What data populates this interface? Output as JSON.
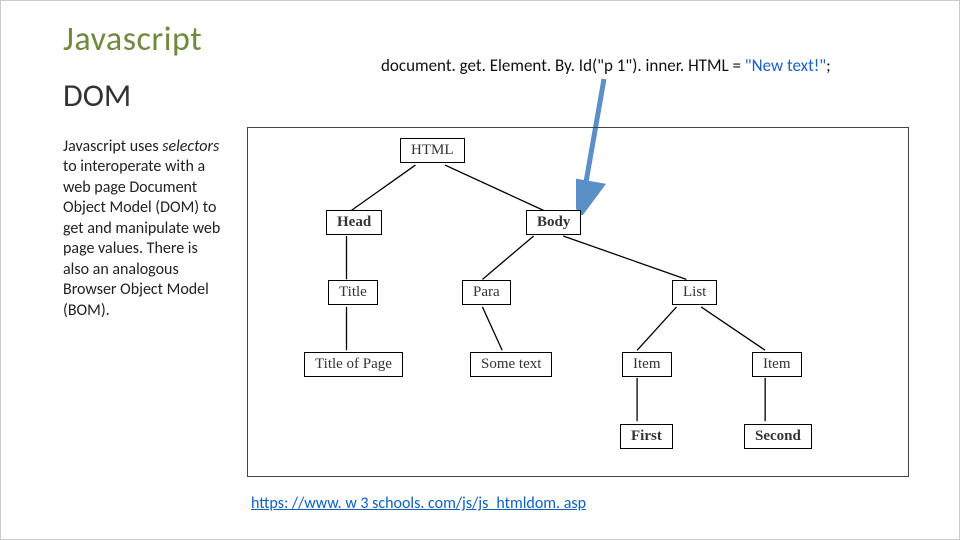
{
  "title": "Javascript",
  "subtitle": "DOM",
  "code": {
    "prefix": "document. get. Element. By. Id(\"p 1\"). inner. HTML = ",
    "string": "\"New text!\"",
    "suffix": ";"
  },
  "description": {
    "line1": "Javascript uses ",
    "emph": "selectors",
    "rest": " to interoperate with a web page Document Object Model (DOM) to get and manipulate web page values. There is also an analogous Browser Object Model (BOM)."
  },
  "tree": {
    "root": "HTML",
    "l1": {
      "head": "Head",
      "body": "Body"
    },
    "l2": {
      "title": "Title",
      "para": "Para",
      "list": "List"
    },
    "l3": {
      "titlepg": "Title of Page",
      "sometext": "Some text",
      "item1": "Item",
      "item2": "Item"
    },
    "l4": {
      "first": "First",
      "second": "Second"
    }
  },
  "link": "https: //www. w 3 schools. com/js/js_htmldom. asp"
}
